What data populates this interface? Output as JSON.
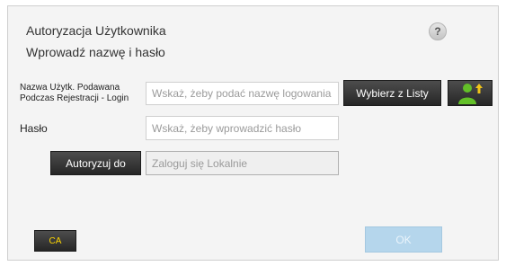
{
  "dialog": {
    "title": "Autoryzacja Użytkownika",
    "subtitle": "Wprowadź nazwę i hasło",
    "help_label": "?"
  },
  "login": {
    "label_line1": "Nazwa Użytk. Podawana",
    "label_line2": "Podczas Rejestracji - Login",
    "placeholder": "Wskaż, żeby podać nazwę logowania",
    "pick_button": "Wybierz z Listy",
    "user_icon": "user-add-icon"
  },
  "password": {
    "label": "Hasło",
    "placeholder": "Wskaż, żeby wprowadzić hasło"
  },
  "auth": {
    "button": "Autoryzuj do",
    "value": "Zaloguj się Lokalnie"
  },
  "footer": {
    "ca_label": "CA",
    "ok_label": "OK"
  },
  "colors": {
    "dark_button": "#333333",
    "ok_button": "#b5d6ec",
    "ca_text": "#ffd700",
    "user_icon_green": "#63c028"
  }
}
